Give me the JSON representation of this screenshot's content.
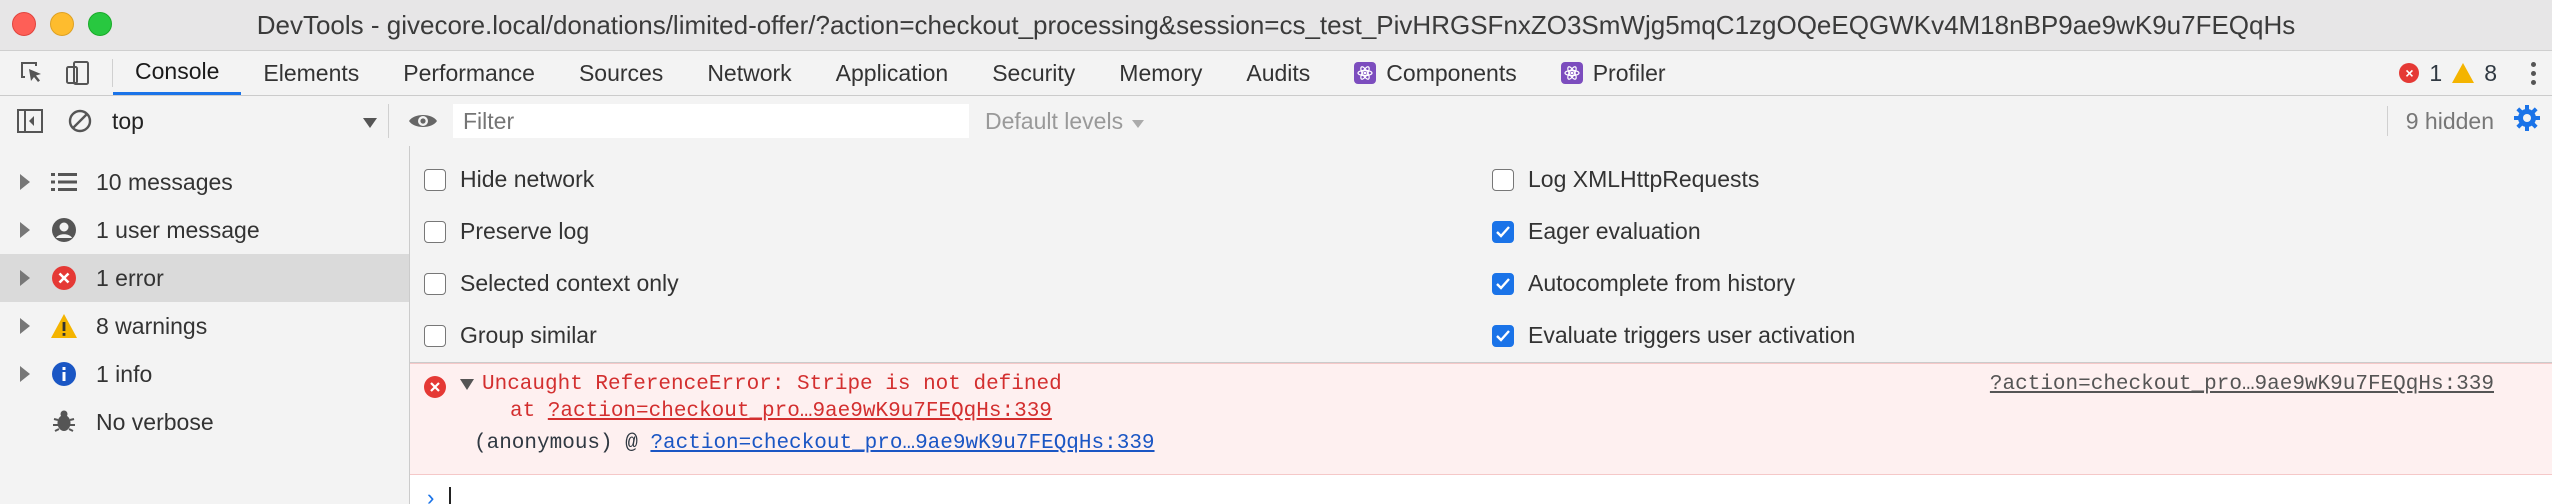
{
  "window": {
    "title": "DevTools - givecore.local/donations/limited-offer/?action=checkout_processing&session=cs_test_PivHRGSFnxZO3SmWjg5mqC1zgOQeEQGWKv4M18nBP9ae9wK9u7FEQqHs"
  },
  "tabs": [
    {
      "label": "Console",
      "active": true
    },
    {
      "label": "Elements"
    },
    {
      "label": "Performance"
    },
    {
      "label": "Sources"
    },
    {
      "label": "Network"
    },
    {
      "label": "Application"
    },
    {
      "label": "Security"
    },
    {
      "label": "Memory"
    },
    {
      "label": "Audits"
    },
    {
      "label": "Components",
      "icon": "react-icon"
    },
    {
      "label": "Profiler",
      "icon": "react-icon"
    }
  ],
  "counts": {
    "errors": "1",
    "warnings": "8"
  },
  "toolbar": {
    "context": "top",
    "filter_placeholder": "Filter",
    "levels": "Default levels",
    "hidden": "9 hidden"
  },
  "sidebar": {
    "items": [
      {
        "label": "10 messages",
        "icon": "list-icon"
      },
      {
        "label": "1 user message",
        "icon": "user-icon"
      },
      {
        "label": "1 error",
        "icon": "error-icon",
        "selected": true
      },
      {
        "label": "8 warnings",
        "icon": "warning-icon"
      },
      {
        "label": "1 info",
        "icon": "info-icon"
      },
      {
        "label": "No verbose",
        "icon": "bug-icon"
      }
    ]
  },
  "settings": {
    "left": [
      {
        "label": "Hide network",
        "checked": false
      },
      {
        "label": "Preserve log",
        "checked": false
      },
      {
        "label": "Selected context only",
        "checked": false
      },
      {
        "label": "Group similar",
        "checked": false
      }
    ],
    "right": [
      {
        "label": "Log XMLHttpRequests",
        "checked": false
      },
      {
        "label": "Eager evaluation",
        "checked": true
      },
      {
        "label": "Autocomplete from history",
        "checked": true
      },
      {
        "label": "Evaluate triggers user activation",
        "checked": true
      }
    ]
  },
  "error": {
    "message": "Uncaught ReferenceError: Stripe is not defined",
    "at_prefix": "at ",
    "at_link": "?action=checkout_pro…9ae9wK9u7FEQqHs:339",
    "anon_prefix": "(anonymous) @ ",
    "anon_link": "?action=checkout_pro…9ae9wK9u7FEQqHs:339",
    "source_link": "?action=checkout_pro…9ae9wK9u7FEQqHs:339"
  },
  "prompt": {
    "symbol": "›"
  },
  "colors": {
    "accent": "#1a73e8",
    "error": "#d32f2f",
    "warning": "#f4b400"
  }
}
